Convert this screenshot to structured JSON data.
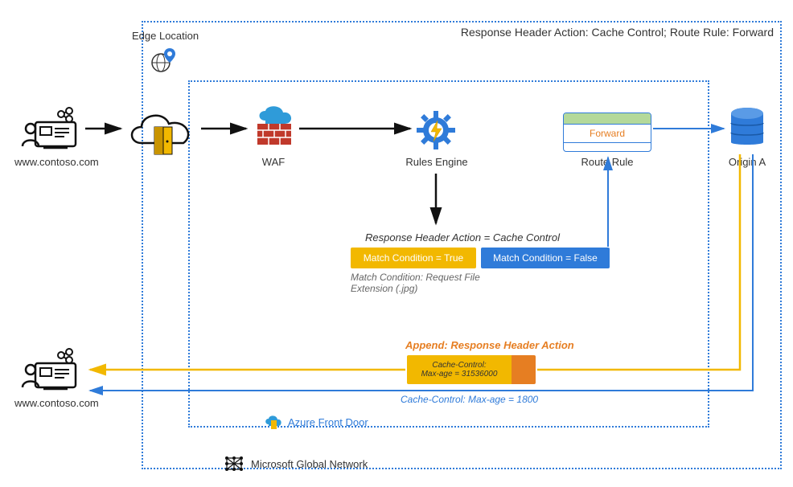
{
  "title": "Response Header Action: Cache Control; Route Rule: Forward",
  "edge_location": "Edge Location",
  "user1_label": "www.contoso.com",
  "user2_label": "www.contoso.com",
  "waf_label": "WAF",
  "rules_engine_label": "Rules Engine",
  "route_rule_label": "Route Rule",
  "route_forward": "Forward",
  "origin_label": "Origin A",
  "response_header_action": "Response Header Action = Cache Control",
  "match_true": "Match Condition = True",
  "match_false": "Match Condition = False",
  "match_note": "Match Condition: Request File Extension (.jpg)",
  "append_title": "Append: Response Header Action",
  "append_cache1": "Cache-Control:",
  "append_cache2": "Max-age = 31536000",
  "blue_cache": "Cache-Control: Max-age = 1800",
  "afd_label": "Azure Front Door",
  "mgn_label": "Microsoft Global Network"
}
